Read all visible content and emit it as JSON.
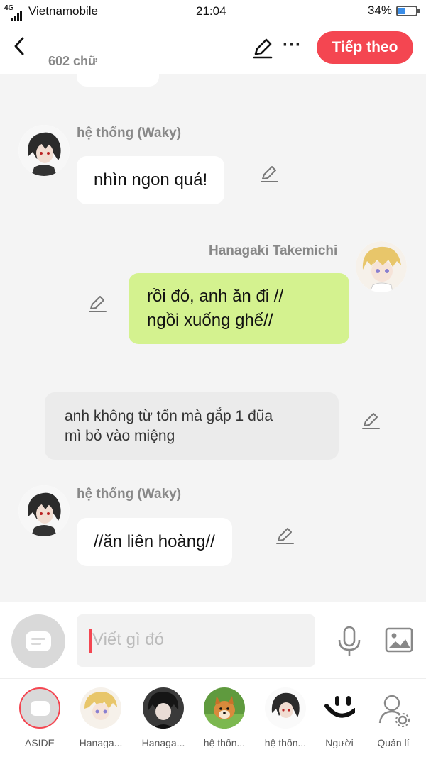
{
  "status_bar": {
    "network": "4G",
    "carrier": "Vietnamobile",
    "time": "21:04",
    "battery": "34%"
  },
  "header": {
    "word_count": "602 chữ",
    "next_label": "Tiếp theo"
  },
  "messages": [
    {
      "type": "left",
      "author": "hệ thống (Waky)",
      "text": "nhìn ngon quá!"
    },
    {
      "type": "right",
      "author": "Hanagaki Takemichi",
      "line1": "rồi đó, anh ăn đi //",
      "line2": "ngồi xuống ghế//"
    },
    {
      "type": "narration",
      "line1": "anh không từ tốn mà gắp  1 đũa",
      "line2": "mì bỏ vào miệng"
    },
    {
      "type": "left",
      "author": "hệ thống (Waky)",
      "text": "//ăn liên hoàng//"
    }
  ],
  "input": {
    "placeholder": "Viết gì đó"
  },
  "nav": [
    {
      "label": "ASIDE"
    },
    {
      "label": "Hanaga..."
    },
    {
      "label": "Hanaga..."
    },
    {
      "label": "hệ thốn..."
    },
    {
      "label": "hệ thốn..."
    },
    {
      "label": "Người"
    },
    {
      "label": "Quản lí"
    }
  ],
  "colors": {
    "accent": "#f44651",
    "green_bubble": "#d4f28f",
    "background": "#f4f4f4"
  },
  "icons": {
    "back": "chevron-left-icon",
    "edit": "pencil-icon",
    "more": "more-icon",
    "mic": "microphone-icon",
    "image": "image-icon",
    "settings": "user-settings-icon"
  }
}
